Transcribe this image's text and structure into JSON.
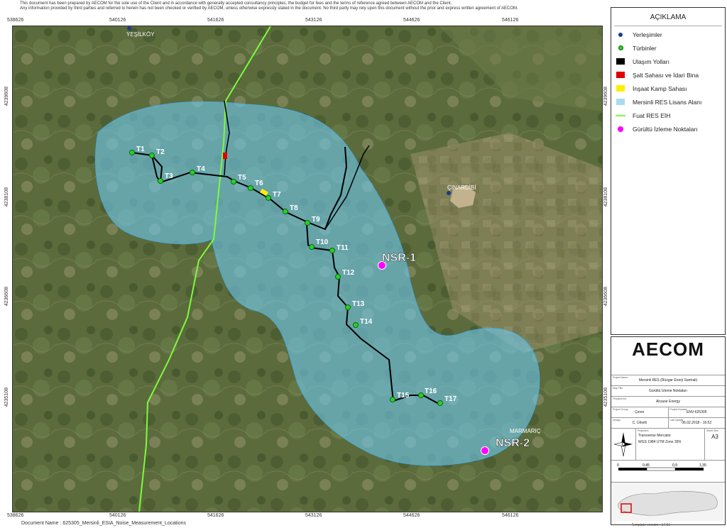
{
  "disclaimer": {
    "line1": "This document has been prepared by AECOM for the sole use of the Client and in accordance with generally accepted consultancy principles, the budget for fees and the terms of reference agreed between AECOM and the Client.",
    "line2": "Any information provided by third parties and referred to herein has not been checked or verified by AECOM, unless otherwise expressly stated in the document. No third party may rely upon this document without the prior and express written agreement of AECOM."
  },
  "grid": {
    "x_labels": [
      "538626",
      "540126",
      "541626",
      "543126",
      "544626",
      "546126"
    ],
    "y_labels": [
      "4239608",
      "4238108",
      "4236608",
      "4235108"
    ]
  },
  "places": [
    {
      "name": "YEŞİLKÖY"
    },
    {
      "name": "ÇINARDİBİ"
    },
    {
      "name": "MARMARIÇ"
    }
  ],
  "turbines": [
    "T1",
    "T2",
    "T3",
    "T4",
    "T5",
    "T6",
    "T7",
    "T8",
    "T9",
    "T10",
    "T11",
    "T12",
    "T13",
    "T14",
    "T15",
    "T16",
    "T17"
  ],
  "noise_points": [
    "NSR-1",
    "NSR-2"
  ],
  "legend": {
    "title": "AÇIKLAMA",
    "items": [
      {
        "label": "Yerleşimler",
        "symbol": "dot",
        "color": "#1f3a8a"
      },
      {
        "label": "Türbinler",
        "symbol": "ring",
        "color": "#2bcf2b"
      },
      {
        "label": "Ulaşım Yolları",
        "symbol": "square",
        "color": "#000000"
      },
      {
        "label": "Şalt Sahası ve İdari Bina",
        "symbol": "square",
        "color": "#e00000"
      },
      {
        "label": "İnşaat Kamp Sahası",
        "symbol": "square",
        "color": "#ffee00"
      },
      {
        "label": "Mersinli RES Lisans Alanı",
        "symbol": "square",
        "color": "#a9dcef"
      },
      {
        "label": "Fuat RES EİH",
        "symbol": "line",
        "color": "#7cfc3c"
      },
      {
        "label": "Gürültü İzleme Noktaları",
        "symbol": "dot",
        "color": "#ff00ff"
      }
    ]
  },
  "title_block": {
    "logo": "AECOM",
    "project_label": "Project Name",
    "project": "Mersinli RES (Rüzgar Enerji Santrali)",
    "map_title_label": "Map Title",
    "map_title": "Gürültü İzleme Noktaları",
    "prepared_for_label": "Prepared for",
    "prepared_for": "Alcazar Energy",
    "group_label": "Project Group",
    "group": "Çevre",
    "project_number_label": "Project Number",
    "project_number": "ENV-625305",
    "design_label": "Design",
    "design": "C. Ürkelli",
    "last_update_label": "Last Update",
    "last_update": "06.02.2018 - 16:52",
    "projection_label": "Projection",
    "projection": "Transverse Mercator",
    "datum": "WGS 1984 UTM Zone 35N",
    "sheet_size_label": "Sheet Size",
    "sheet_size": "A3",
    "scale_labels": [
      "0",
      "0,45",
      "0,9",
      "1,35"
    ]
  },
  "footer": {
    "document_name": "Document Name : 625305_Mersinli_ESIA_Noise_Measurement_Locations",
    "template_version": "Template version : 17.01"
  }
}
